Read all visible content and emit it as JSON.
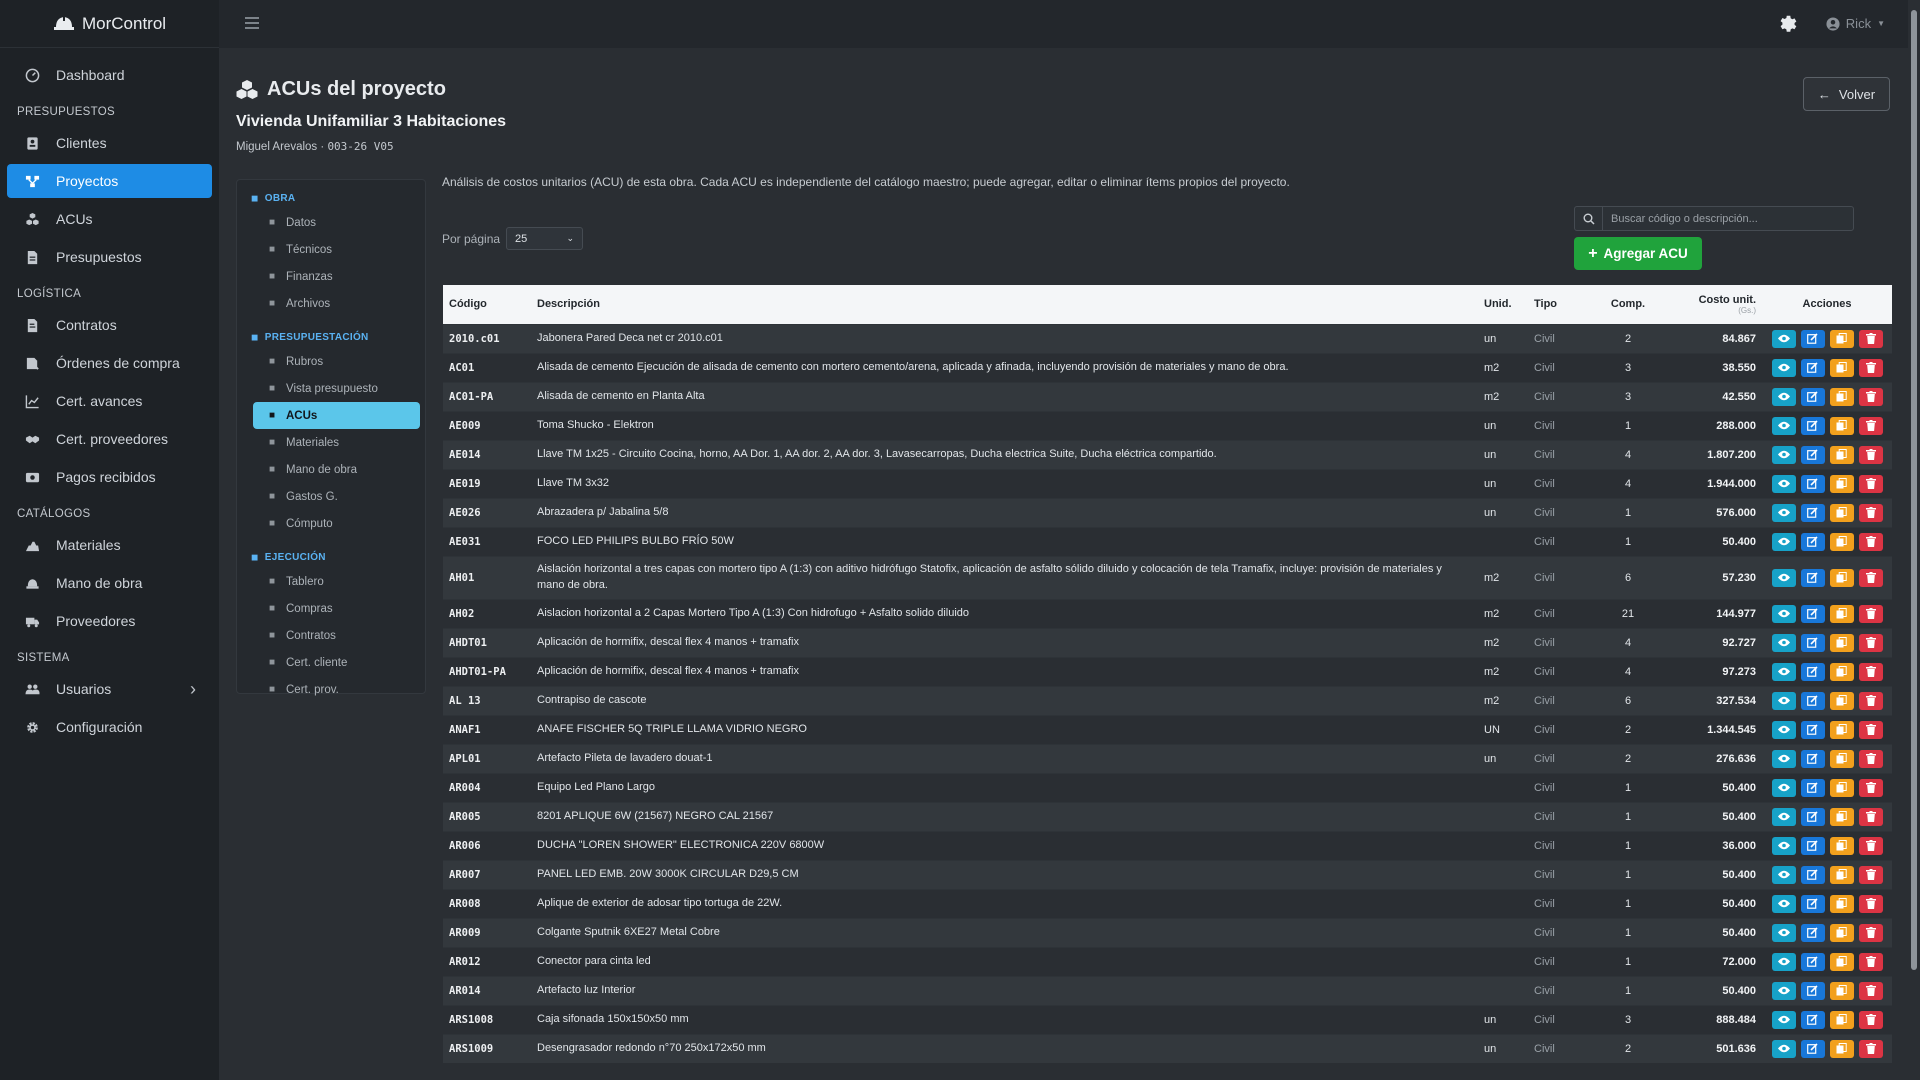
{
  "app": {
    "name": "MorControl"
  },
  "topbar": {
    "user": "Rick"
  },
  "sidebar": {
    "items": [
      {
        "type": "item",
        "label": "Dashboard",
        "icon": "dashboard-icon"
      },
      {
        "type": "header",
        "label": "PRESUPUESTOS"
      },
      {
        "type": "item",
        "label": "Clientes",
        "icon": "clients-icon"
      },
      {
        "type": "item",
        "label": "Proyectos",
        "icon": "projects-icon",
        "active": true
      },
      {
        "type": "item",
        "label": "ACUs",
        "icon": "acus-icon"
      },
      {
        "type": "item",
        "label": "Presupuestos",
        "icon": "budgets-icon"
      },
      {
        "type": "header",
        "label": "LOGÍSTICA"
      },
      {
        "type": "item",
        "label": "Contratos",
        "icon": "contracts-icon"
      },
      {
        "type": "item",
        "label": "Órdenes de compra",
        "icon": "purchase-orders-icon"
      },
      {
        "type": "item",
        "label": "Cert. avances",
        "icon": "chart-icon"
      },
      {
        "type": "item",
        "label": "Cert. proveedores",
        "icon": "handshake-icon"
      },
      {
        "type": "item",
        "label": "Pagos recibidos",
        "icon": "money-icon"
      },
      {
        "type": "header",
        "label": "CATÁLOGOS"
      },
      {
        "type": "item",
        "label": "Materiales",
        "icon": "materials-icon"
      },
      {
        "type": "item",
        "label": "Mano de obra",
        "icon": "workers-icon"
      },
      {
        "type": "item",
        "label": "Proveedores",
        "icon": "truck-icon"
      },
      {
        "type": "header",
        "label": "SISTEMA"
      },
      {
        "type": "item",
        "label": "Usuarios",
        "icon": "users-icon",
        "chevron": true
      },
      {
        "type": "item",
        "label": "Configuración",
        "icon": "gear-icon"
      }
    ]
  },
  "page": {
    "title": "ACUs del proyecto",
    "subtitle": "Vivienda Unifamiliar 3 Habitaciones",
    "client": "Miguel Arevalos",
    "separator": "·",
    "code": "003-26 V05",
    "back_label": "Volver",
    "intro": "Análisis de costos unitarios (ACU) de esta obra. Cada ACU es independiente del catálogo maestro; puede agregar, editar o eliminar ítems propios del proyecto.",
    "per_page_label": "Por página",
    "per_page_value": "25",
    "search_placeholder": "Buscar código o descripción...",
    "add_label": "Agregar ACU"
  },
  "subnav": {
    "sections": [
      {
        "title": "OBRA",
        "items": [
          "Datos",
          "Técnicos",
          "Finanzas",
          "Archivos"
        ]
      },
      {
        "title": "PRESUPUESTACIÓN",
        "items": [
          "Rubros",
          "Vista presupuesto",
          "ACUs",
          "Materiales",
          "Mano de obra",
          "Gastos G.",
          "Cómputo"
        ],
        "active": "ACUs"
      },
      {
        "title": "EJECUCIÓN",
        "items": [
          "Tablero",
          "Compras",
          "Contratos",
          "Cert. cliente",
          "Cert. prov."
        ]
      }
    ]
  },
  "table": {
    "headers": {
      "code": "Código",
      "desc": "Descripción",
      "unit": "Unid.",
      "type": "Tipo",
      "comp": "Comp.",
      "cost": "Costo unit.",
      "cost_sub": "(Gs.)",
      "actions": "Acciones"
    },
    "rows": [
      {
        "code": "2010.c01",
        "desc": "Jabonera Pared Deca net cr 2010.c01",
        "unit": "un",
        "type": "Civil",
        "comp": "2",
        "cost": "84.867"
      },
      {
        "code": "AC01",
        "desc": "Alisada de cemento Ejecución de alisada de cemento con mortero cemento/arena, aplicada y afinada, incluyendo provisión de materiales y mano de obra.",
        "unit": "m2",
        "type": "Civil",
        "comp": "3",
        "cost": "38.550"
      },
      {
        "code": "AC01-PA",
        "desc": "Alisada de cemento en Planta Alta",
        "unit": "m2",
        "type": "Civil",
        "comp": "3",
        "cost": "42.550"
      },
      {
        "code": "AE009",
        "desc": "Toma Shucko - Elektron",
        "unit": "un",
        "type": "Civil",
        "comp": "1",
        "cost": "288.000"
      },
      {
        "code": "AE014",
        "desc": "Llave TM 1x25 - Circuito Cocina, horno, AA Dor. 1, AA dor. 2, AA dor. 3, Lavasecarropas, Ducha electrica Suite, Ducha eléctrica compartido.",
        "unit": "un",
        "type": "Civil",
        "comp": "4",
        "cost": "1.807.200"
      },
      {
        "code": "AE019",
        "desc": "Llave TM 3x32",
        "unit": "un",
        "type": "Civil",
        "comp": "4",
        "cost": "1.944.000"
      },
      {
        "code": "AE026",
        "desc": "Abrazadera p/ Jabalina 5/8",
        "unit": "un",
        "type": "Civil",
        "comp": "1",
        "cost": "576.000"
      },
      {
        "code": "AE031",
        "desc": "FOCO LED PHILIPS BULBO FRÍO 50W",
        "unit": "",
        "type": "Civil",
        "comp": "1",
        "cost": "50.400"
      },
      {
        "code": "AH01",
        "desc": "Aislación horizontal a tres capas con mortero tipo A (1:3) con aditivo hidrófugo Statofix, aplicación de asfalto sólido diluido y colocación de tela Tramafix, incluye: provisión de materiales y mano de obra.",
        "unit": "m2",
        "type": "Civil",
        "comp": "6",
        "cost": "57.230",
        "tall": true
      },
      {
        "code": "AH02",
        "desc": "Aislacion horizontal a 2 Capas Mortero Tipo A (1:3) Con hidrofugo + Asfalto solido diluido",
        "unit": "m2",
        "type": "Civil",
        "comp": "21",
        "cost": "144.977"
      },
      {
        "code": "AHDT01",
        "desc": "Aplicación de hormifix, descal flex 4 manos + tramafix",
        "unit": "m2",
        "type": "Civil",
        "comp": "4",
        "cost": "92.727"
      },
      {
        "code": "AHDT01-PA",
        "desc": "Aplicación de hormifix, descal flex 4 manos + tramafix",
        "unit": "m2",
        "type": "Civil",
        "comp": "4",
        "cost": "97.273"
      },
      {
        "code": "AL 13",
        "desc": "Contrapiso de cascote",
        "unit": "m2",
        "type": "Civil",
        "comp": "6",
        "cost": "327.534"
      },
      {
        "code": "ANAF1",
        "desc": "ANAFE FISCHER 5Q TRIPLE LLAMA VIDRIO NEGRO",
        "unit": "UN",
        "type": "Civil",
        "comp": "2",
        "cost": "1.344.545"
      },
      {
        "code": "APL01",
        "desc": "Artefacto Pileta de lavadero douat-1",
        "unit": "un",
        "type": "Civil",
        "comp": "2",
        "cost": "276.636"
      },
      {
        "code": "AR004",
        "desc": "Equipo Led Plano Largo",
        "unit": "",
        "type": "Civil",
        "comp": "1",
        "cost": "50.400"
      },
      {
        "code": "AR005",
        "desc": "8201 APLIQUE 6W (21567) NEGRO CAL 21567",
        "unit": "",
        "type": "Civil",
        "comp": "1",
        "cost": "50.400"
      },
      {
        "code": "AR006",
        "desc": "DUCHA \"LOREN SHOWER\" ELECTRONICA 220V 6800W",
        "unit": "",
        "type": "Civil",
        "comp": "1",
        "cost": "36.000"
      },
      {
        "code": "AR007",
        "desc": "PANEL LED EMB. 20W 3000K CIRCULAR D29,5 CM",
        "unit": "",
        "type": "Civil",
        "comp": "1",
        "cost": "50.400"
      },
      {
        "code": "AR008",
        "desc": "Aplique de exterior de adosar tipo tortuga de 22W.",
        "unit": "",
        "type": "Civil",
        "comp": "1",
        "cost": "50.400"
      },
      {
        "code": "AR009",
        "desc": "Colgante Sputnik 6XE27 Metal Cobre",
        "unit": "",
        "type": "Civil",
        "comp": "1",
        "cost": "50.400"
      },
      {
        "code": "AR012",
        "desc": "Conector para cinta led",
        "unit": "",
        "type": "Civil",
        "comp": "1",
        "cost": "72.000"
      },
      {
        "code": "AR014",
        "desc": "Artefacto luz Interior",
        "unit": "",
        "type": "Civil",
        "comp": "1",
        "cost": "50.400"
      },
      {
        "code": "ARS1008",
        "desc": "Caja sifonada 150x150x50 mm",
        "unit": "un",
        "type": "Civil",
        "comp": "3",
        "cost": "888.484"
      },
      {
        "code": "ARS1009",
        "desc": "Desengrasador redondo n°70 250x172x50 mm",
        "unit": "un",
        "type": "Civil",
        "comp": "2",
        "cost": "501.636"
      }
    ]
  },
  "colors": {
    "accent": "#1e8ce5",
    "add_button": "#20a33c",
    "view": "#17a2c8",
    "edit": "#1877d9",
    "copy": "#f2a01d",
    "delete": "#dc3444",
    "subnav_active": "#5bc6ea"
  }
}
